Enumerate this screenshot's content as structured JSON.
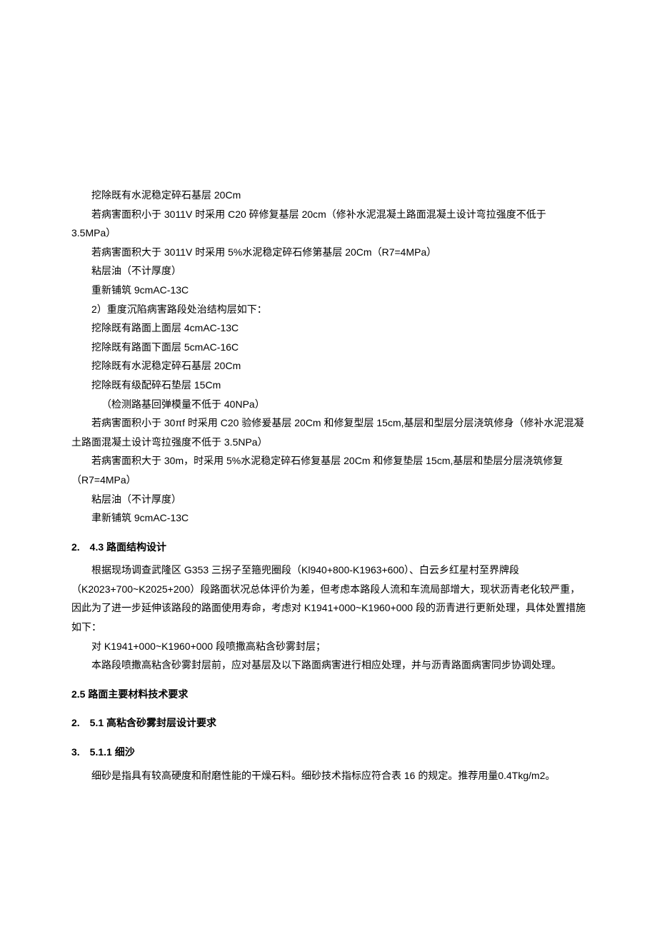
{
  "p1": "挖除既有水泥稳定碎石基层 20Cm",
  "p2": "若病害面积小于 3011V 时采用 C20 碎修复基层 20cm（修补水泥混凝土路面混凝土设计弯拉强度不低于 3.5MPa）",
  "p3": "若病害面积大于 3011V 时采用 5%水泥稳定碎石修第基层 20Cm（R7=4MPa）",
  "p4": "粘层油（不计厚度）",
  "p5": "重新铺筑 9cmAC-13C",
  "p6": "2）重度沉陷病害路段处治结构层如下：",
  "p7": "挖除既有路面上面层 4cmAC-13C",
  "p8": "挖除既有路面下面层 5cmAC-16C",
  "p9": "挖除既有水泥稳定碎石基层 20Cm",
  "p10": "挖除既有级配碎石垫层 15Cm",
  "p11": "（检测路基回弹模量不低于 40NPa）",
  "p12": "若病害面积小于 30πf 时采用 C20 验修爰基层 20Cm 和修复型层 15cm,基层和型层分层浇筑修身（修补水泥混凝土路面混凝土设计弯拉强度不低于 3.5NPa）",
  "p13": "若病害面积大于 30m，时采用 5%水泥稳定碎石修复基层 20Cm 和修复垫层 15cm,基层和垫层分层浇筑修复（R7=4MPa）",
  "p14": "粘层油（不计厚度）",
  "p15": "聿新铺筑 9cmAC-13C",
  "h1": "2.　4.3 路面结构设计",
  "p16": "根据现场调查武隆区 G353 三拐子至箍兜圈段（Kl940+800-K1963+600）、白云乡红星村至界牌段（K2023+700~K2025+200）段路面状况总体评价为差，但考虑本路段人流和车流局部增大，现状沥青老化较严重，因此为了进一步延伸该路段的路面使用寿命，考虑对 K1941+000~K1960+000 段的沥青进行更新处理，具体处置措施如下：",
  "p17": "对 K1941+000~K1960+000 段喷撒高粘含砂雾封层；",
  "p18": "本路段喷撒高粘含砂雾封层前，应对基层及以下路面病害进行相应处理，并与沥青路面病害同步协调处理。",
  "h2": "2.5 路面主要材料技术要求",
  "h3": "2.　5.1 高粘含砂雾封层设计要求",
  "h4": "3.　5.1.1 细沙",
  "p19": "细砂是指具有较高硬度和耐磨性能的干燥石料。细砂技术指标应符合表 16 的规定。推荐用量0.4Tkg/m2。"
}
